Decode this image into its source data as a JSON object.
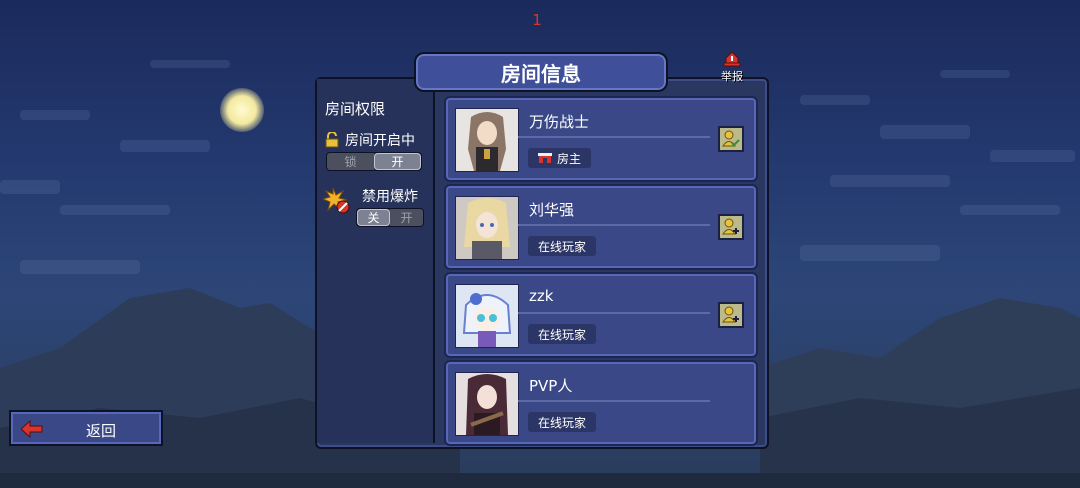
{
  "counter": "1",
  "title": "房间信息",
  "report_label": "举报",
  "permissions": {
    "section_title": "房间权限",
    "room_status_label": "房间开启中",
    "room_toggle": {
      "off_label": "锁",
      "on_label": "开",
      "selected": "on"
    },
    "explode_label": "禁用爆炸",
    "explode_toggle": {
      "off_label": "关",
      "on_label": "开",
      "selected": "off"
    }
  },
  "players": [
    {
      "name": "万伤战士",
      "badge": "房主",
      "badge_icon": "host-house-icon",
      "action_icon": "friend-accepted-icon"
    },
    {
      "name": "刘华强",
      "badge": "在线玩家",
      "badge_icon": "",
      "action_icon": "add-friend-icon"
    },
    {
      "name": "zzk",
      "badge": "在线玩家",
      "badge_icon": "",
      "action_icon": "add-friend-icon"
    },
    {
      "name": "PVP人",
      "badge": "在线玩家",
      "badge_icon": "",
      "action_icon": ""
    }
  ],
  "back_button_label": "返回",
  "colors": {
    "accent": "#3f4f9a",
    "report_red": "#d8342c",
    "friend_button": "#bcb98b"
  }
}
